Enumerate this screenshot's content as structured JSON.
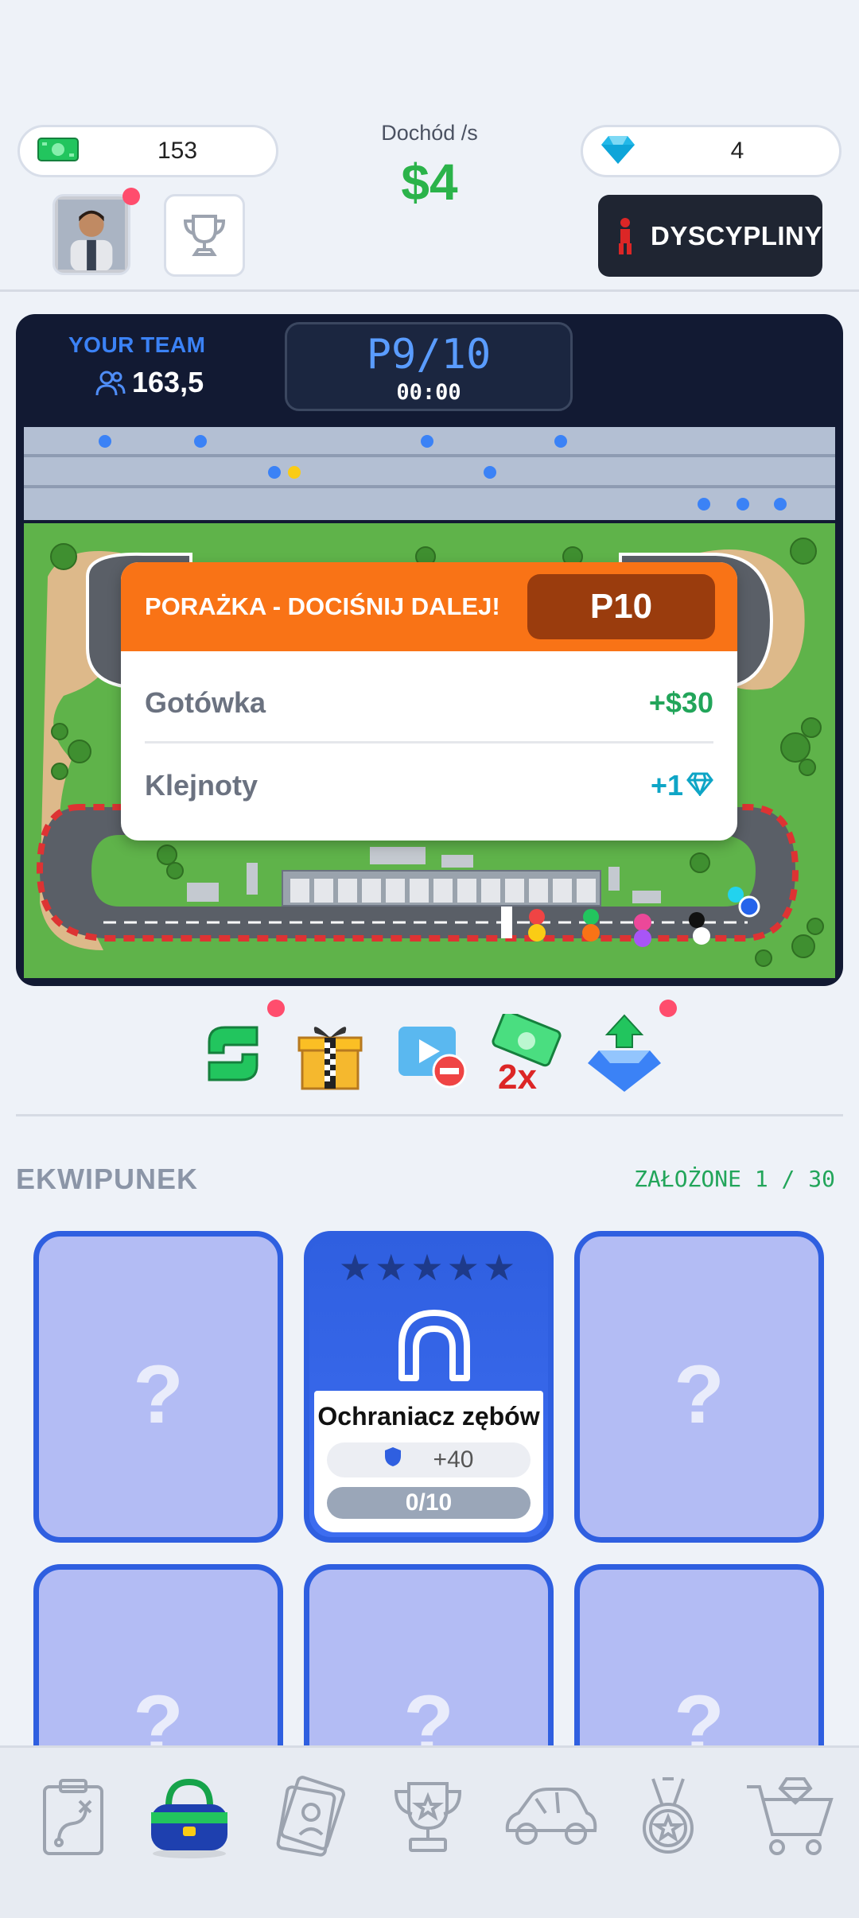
{
  "header": {
    "cash": "153",
    "income_label": "Dochód /s",
    "income_value": "$4",
    "gems": "4",
    "disciplines_label": "DYSCYPLINY"
  },
  "race": {
    "team_label": "YOUR TEAM",
    "team_value": "163,5",
    "position": "P9/10",
    "timer": "00:00"
  },
  "result_popup": {
    "title": "PORAŻKA - DOCIŚNIJ DALEJ!",
    "position_badge": "P10",
    "rows": [
      {
        "label": "Gotówka",
        "value": "+$30"
      },
      {
        "label": "Klejnoty",
        "value": "+1"
      }
    ]
  },
  "actions": [
    "exchange-icon",
    "gift-icon",
    "ad-blocked-icon",
    "cash-2x-icon",
    "gem-upgrade-icon"
  ],
  "inventory": {
    "title": "EKWIPUNEK",
    "equipped_count": "ZAŁOŻONE 1 / 30",
    "locked_mark": "?",
    "equipped_item": {
      "stars": "★★★★★",
      "name": "Ochraniacz zębów",
      "stat": "+40",
      "progress": "0/10"
    }
  },
  "colors": {
    "accent_green": "#2bb34a",
    "popup_orange": "#f97316",
    "card_blue": "#2f5fe0",
    "panel_dark": "#121a33"
  },
  "nav": [
    "strategy-icon",
    "gear-bag-icon",
    "cards-icon",
    "trophy-icon",
    "car-icon",
    "medal-icon",
    "shop-cart-icon"
  ]
}
